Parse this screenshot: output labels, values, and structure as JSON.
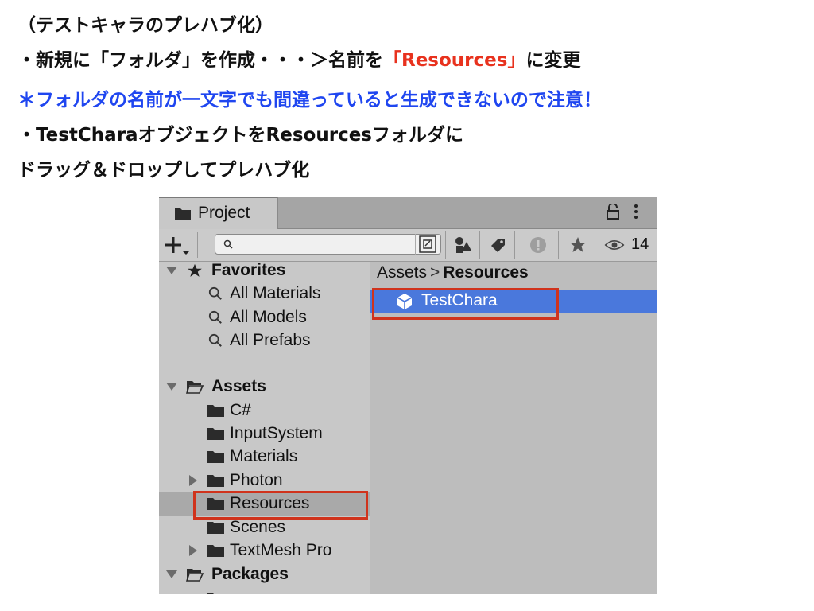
{
  "captions": {
    "line1": "（テストキャラのプレハブ化）",
    "line2_a": "・新規に「フォルダ」を作成・・・＞名前を",
    "line2_b": "「Resources」",
    "line2_c": "に変更",
    "line3": "＊フォルダの名前が一文字でも間違っていると生成できないので注意！",
    "line4": "・TestCharaオブジェクトをResourcesフォルダに",
    "line5": "ドラッグ＆ドロップしてプレハブ化"
  },
  "colors": {
    "caption_text": "#111111",
    "note_blue": "#1f46f0",
    "emphasis_red": "#e8321e",
    "selection_blue": "#4a78dc",
    "highlight_red": "#d0331c"
  },
  "window": {
    "tab_label": "Project",
    "hidden_count": "14",
    "icons": [
      "folder-icon",
      "lock-icon",
      "kebab-menu-icon",
      "add-icon",
      "search-icon",
      "search-toggle-icon",
      "type-filter-icon",
      "label-filter-icon",
      "warning-icon",
      "favorite-icon",
      "eye-icon"
    ]
  },
  "tree": {
    "favorites": {
      "label": "Favorites",
      "items": [
        "All Materials",
        "All Models",
        "All Prefabs"
      ]
    },
    "assets": {
      "label": "Assets",
      "items": [
        "C#",
        "InputSystem",
        "Materials",
        "Photon",
        "Resources",
        "Scenes",
        "TextMesh Pro"
      ]
    },
    "packages": {
      "label": "Packages"
    }
  },
  "breadcrumb": {
    "root": "Assets",
    "separator": ">",
    "current": "Resources"
  },
  "assets_view": {
    "item": "TestChara"
  }
}
